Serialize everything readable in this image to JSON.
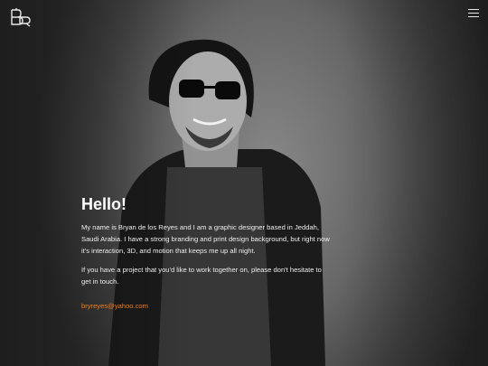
{
  "brand": {
    "logo_icon": "br-monogram-icon"
  },
  "nav": {
    "menu_icon": "hamburger-menu-icon"
  },
  "intro": {
    "heading": "Hello!",
    "paragraph_1": "My name is Bryan de los Reyes and I am a graphic designer based in Jeddah, Saudi Arabia. I have a strong branding and print design background, but right now it's interaction, 3D, and motion that keeps me up all night.",
    "paragraph_2": "If you have a project that you'd like to work together on, please don't hesitate to get in touch.",
    "email": "bryreyes@yahoo.com"
  },
  "colors": {
    "accent": "#f07d1a",
    "text": "#ffffff",
    "background": "#3c3c3c"
  }
}
